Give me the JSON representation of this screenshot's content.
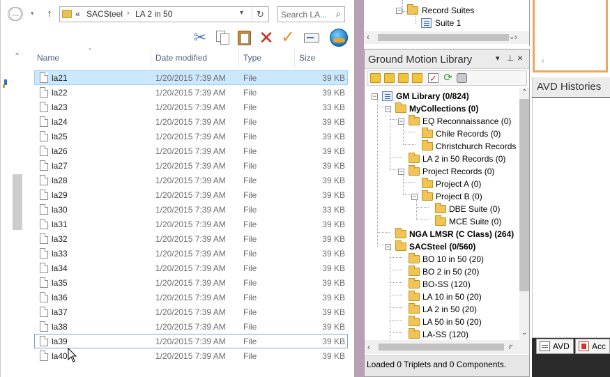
{
  "explorer": {
    "nav": {
      "back_glyph": "←",
      "forward_glyph": "→",
      "up_glyph": "↑"
    },
    "address": {
      "prefix": "«",
      "segments": [
        "SACSteel",
        "LA 2 in 50"
      ],
      "separator": "›"
    },
    "search": {
      "placeholder": "Search LA..."
    },
    "columns": {
      "name": "Name",
      "date": "Date modified",
      "type": "Type",
      "size": "Size"
    },
    "files": [
      {
        "name": "la21",
        "date": "1/20/2015 7:39 AM",
        "type": "File",
        "size": "39 KB"
      },
      {
        "name": "la22",
        "date": "1/20/2015 7:39 AM",
        "type": "File",
        "size": "39 KB"
      },
      {
        "name": "la23",
        "date": "1/20/2015 7:39 AM",
        "type": "File",
        "size": "33 KB"
      },
      {
        "name": "la24",
        "date": "1/20/2015 7:39 AM",
        "type": "File",
        "size": "39 KB"
      },
      {
        "name": "la25",
        "date": "1/20/2015 7:39 AM",
        "type": "File",
        "size": "39 KB"
      },
      {
        "name": "la26",
        "date": "1/20/2015 7:39 AM",
        "type": "File",
        "size": "39 KB"
      },
      {
        "name": "la27",
        "date": "1/20/2015 7:39 AM",
        "type": "File",
        "size": "39 KB"
      },
      {
        "name": "la28",
        "date": "1/20/2015 7:39 AM",
        "type": "File",
        "size": "39 KB"
      },
      {
        "name": "la29",
        "date": "1/20/2015 7:39 AM",
        "type": "File",
        "size": "39 KB"
      },
      {
        "name": "la30",
        "date": "1/20/2015 7:39 AM",
        "type": "File",
        "size": "33 KB"
      },
      {
        "name": "la31",
        "date": "1/20/2015 7:39 AM",
        "type": "File",
        "size": "39 KB"
      },
      {
        "name": "la32",
        "date": "1/20/2015 7:39 AM",
        "type": "File",
        "size": "39 KB"
      },
      {
        "name": "la33",
        "date": "1/20/2015 7:39 AM",
        "type": "File",
        "size": "39 KB"
      },
      {
        "name": "la34",
        "date": "1/20/2015 7:39 AM",
        "type": "File",
        "size": "39 KB"
      },
      {
        "name": "la35",
        "date": "1/20/2015 7:39 AM",
        "type": "File",
        "size": "39 KB"
      },
      {
        "name": "la36",
        "date": "1/20/2015 7:39 AM",
        "type": "File",
        "size": "39 KB"
      },
      {
        "name": "la37",
        "date": "1/20/2015 7:39 AM",
        "type": "File",
        "size": "39 KB"
      },
      {
        "name": "la38",
        "date": "1/20/2015 7:39 AM",
        "type": "File",
        "size": "39 KB"
      },
      {
        "name": "la39",
        "date": "1/20/2015 7:39 AM",
        "type": "File",
        "size": "39 KB"
      },
      {
        "name": "la40",
        "date": "1/20/2015 7:39 AM",
        "type": "File",
        "size": "39 KB"
      }
    ],
    "selected_file": "la21",
    "focused_file": "la39"
  },
  "gm_top": {
    "nodes": [
      {
        "label": "Record Suites"
      },
      {
        "label": "Suite 1"
      }
    ]
  },
  "gm_library": {
    "title": "Ground Motion Library",
    "controls": {
      "dropdown": "▾",
      "pin": "⊥",
      "close": "×"
    },
    "tree": [
      {
        "label": "GM Library (0/824)",
        "bold": true,
        "icon": "library-icon",
        "toggle": "−"
      },
      {
        "label": "MyCollections (0)",
        "bold": true,
        "toggle": "−"
      },
      {
        "label": "EQ Reconnaissance (0)",
        "toggle": "−"
      },
      {
        "label": "Chile Records (0)"
      },
      {
        "label": "Christchurch Records"
      },
      {
        "label": "LA 2 in 50 Records (0)"
      },
      {
        "label": "Project Records (0)",
        "toggle": "−"
      },
      {
        "label": "Project A (0)"
      },
      {
        "label": "Project B (0)",
        "toggle": "−"
      },
      {
        "label": "DBE Suite (0)"
      },
      {
        "label": "MCE Suite (0)"
      },
      {
        "label": "NGA LMSR (C Class) (264)",
        "bold": true
      },
      {
        "label": "SACSteel (0/560)",
        "bold": true,
        "toggle": "−"
      },
      {
        "label": "BO 10 in 50 (20)"
      },
      {
        "label": "BO 2 in 50 (20)"
      },
      {
        "label": "BO-SS (120)"
      },
      {
        "label": "LA 10 in 50 (20)"
      },
      {
        "label": "LA 2 in 50 (20)"
      },
      {
        "label": "LA 50 in 50 (20)"
      },
      {
        "label": "LA-SS (120)"
      }
    ],
    "status": "Loaded 0 Triplets and 0 Components."
  },
  "avd": {
    "histories_title": "AVD Histories",
    "tabs": [
      {
        "label": "AVD"
      },
      {
        "label": "Acc"
      }
    ]
  },
  "colors": {
    "selection_fill": "#cce8ff",
    "selection_border": "#99d1ff",
    "divider": "#b89fb5",
    "avd_frame": "#f2a65a",
    "dark_background": "#2b2b2b"
  }
}
